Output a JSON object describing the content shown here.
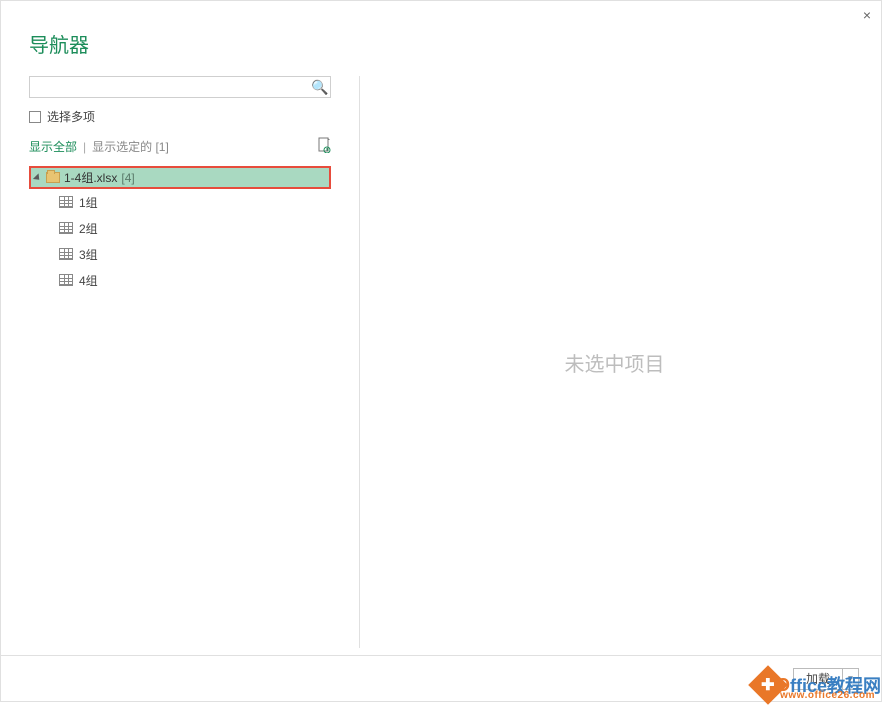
{
  "dialog": {
    "title": "导航器",
    "close_symbol": "×"
  },
  "search": {
    "value": "",
    "icon_symbol": "🔍"
  },
  "options": {
    "multi_select_label": "选择多项"
  },
  "toolbar": {
    "show_all": "显示全部",
    "show_selected": "显示选定的 [1]",
    "refresh_symbol": "🗋"
  },
  "tree": {
    "root": {
      "label": "1-4组.xlsx",
      "count": "[4]"
    },
    "children": [
      {
        "label": "1组"
      },
      {
        "label": "2组"
      },
      {
        "label": "3组"
      },
      {
        "label": "4组"
      }
    ]
  },
  "preview": {
    "empty_text": "未选中项目"
  },
  "footer": {
    "load_label": "加载",
    "dropdown_symbol": "▼"
  },
  "watermark": {
    "text_o": "O",
    "text_rest": "ffice教程网",
    "url": "www.office26.com"
  }
}
